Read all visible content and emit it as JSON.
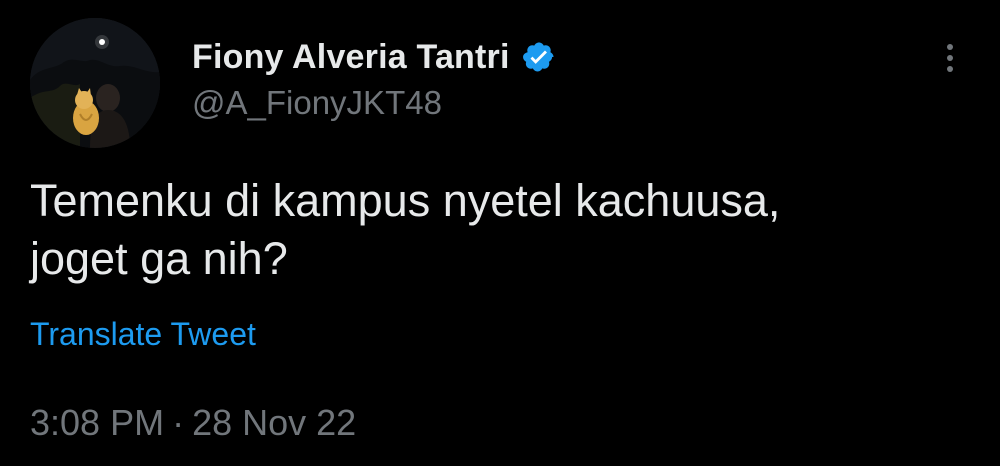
{
  "tweet": {
    "author": {
      "display_name": "Fiony Alveria Tantri",
      "handle": "@A_FionyJKT48",
      "verified": true,
      "avatar_icon": "profile-photo-night-sky-with-cat"
    },
    "text": "Temenku di kampus nyetel kachuusa,\njoget ga nih?",
    "translate_label": "Translate Tweet",
    "time": "3:08 PM",
    "separator": "·",
    "date": "28 Nov 22",
    "more_icon": "more-options-icon"
  },
  "colors": {
    "background": "#000000",
    "primary_text": "#e7e9ea",
    "secondary_text": "#71767b",
    "link": "#1d9bf0",
    "verified_badge": "#1d9bf0"
  }
}
